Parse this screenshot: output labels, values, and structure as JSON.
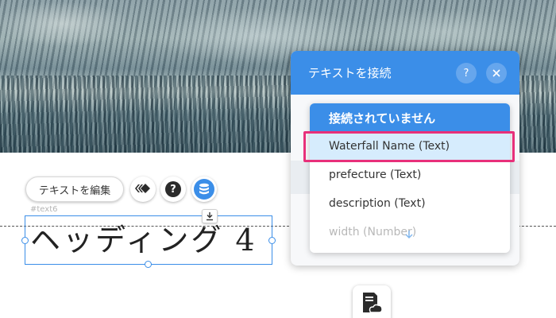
{
  "toolbar": {
    "edit_text_label": "テキストを編集",
    "help_label": "?"
  },
  "element": {
    "id_label": "#text6",
    "heading_text": "ヘッディング 4"
  },
  "connect_panel": {
    "title": "テキストを接続",
    "help_label": "?",
    "close_label": "×",
    "options": [
      "接続されていません",
      "Waterfall Name (Text)",
      "prefecture (Text)",
      "description (Text)",
      "width (Number)"
    ],
    "selected_option": "接続されていません",
    "highlighted_option": "Waterfall Name (Text)"
  },
  "colors": {
    "accent": "#3b8ee8",
    "highlight_border": "#e8307a",
    "hover_row": "#d6ecfd"
  },
  "icons": [
    "animation-icon",
    "help-icon",
    "database-icon",
    "download-icon",
    "close-icon",
    "chevron-down-icon",
    "document-cloud-icon"
  ]
}
